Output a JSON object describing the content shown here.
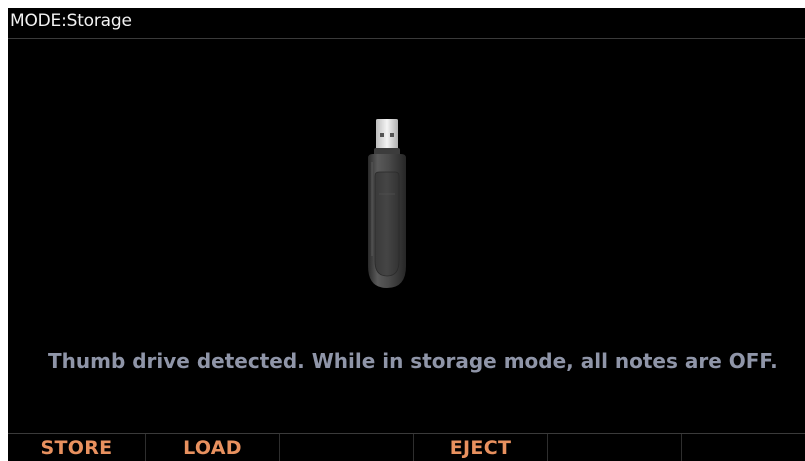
{
  "header": {
    "mode_title": "MODE:Storage"
  },
  "device": {
    "icon": "usb-thumb-drive-icon"
  },
  "status": {
    "message": "Thumb drive detected. While in storage mode, all notes are OFF."
  },
  "softkeys": [
    {
      "label": "STORE"
    },
    {
      "label": "LOAD"
    },
    {
      "label": ""
    },
    {
      "label": "EJECT"
    },
    {
      "label": ""
    },
    {
      "label": ""
    }
  ],
  "colors": {
    "background": "#000000",
    "title_text": "#f2f2f2",
    "message_text": "#8f95a8",
    "softkey_text": "#e8915f"
  }
}
